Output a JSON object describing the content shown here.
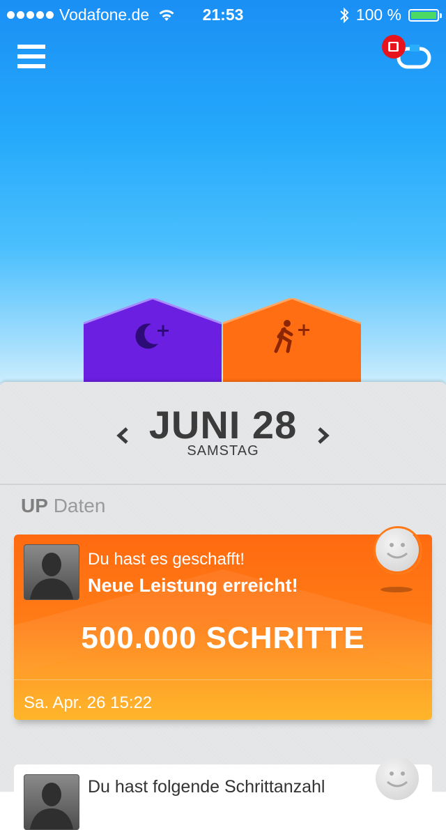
{
  "status_bar": {
    "carrier": "Vodafone.de",
    "time": "21:53",
    "battery": "100 %",
    "colors": {
      "battery_fill": "#4cd964"
    }
  },
  "nav": {
    "menu_icon": "hamburger-menu-icon",
    "sync_icon": "band-sync-icon",
    "sync_badge_color": "#e8141d"
  },
  "houses": [
    {
      "name": "sleep",
      "icon": "moon-plus-icon",
      "color": "#6b1fe0"
    },
    {
      "name": "activity",
      "icon": "runner-plus-icon",
      "color": "#ff6e12"
    }
  ],
  "date": {
    "main": "JUNI 28",
    "weekday": "SAMSTAG",
    "prev_icon": "chevron-left-icon",
    "next_icon": "chevron-right-icon"
  },
  "section": {
    "brand": "UP",
    "title": "Daten"
  },
  "feed": [
    {
      "line1": "Du hast es geschafft!",
      "line2": "Neue Leistung erreicht!",
      "highlight": "500.000 SCHRITTE",
      "timestamp": "Sa. Apr. 26 15:22",
      "colors": {
        "top": "#ff6a10",
        "bottom": "#ffb21d"
      }
    },
    {
      "line1": "Du hast folgende Schrittanzahl"
    }
  ]
}
